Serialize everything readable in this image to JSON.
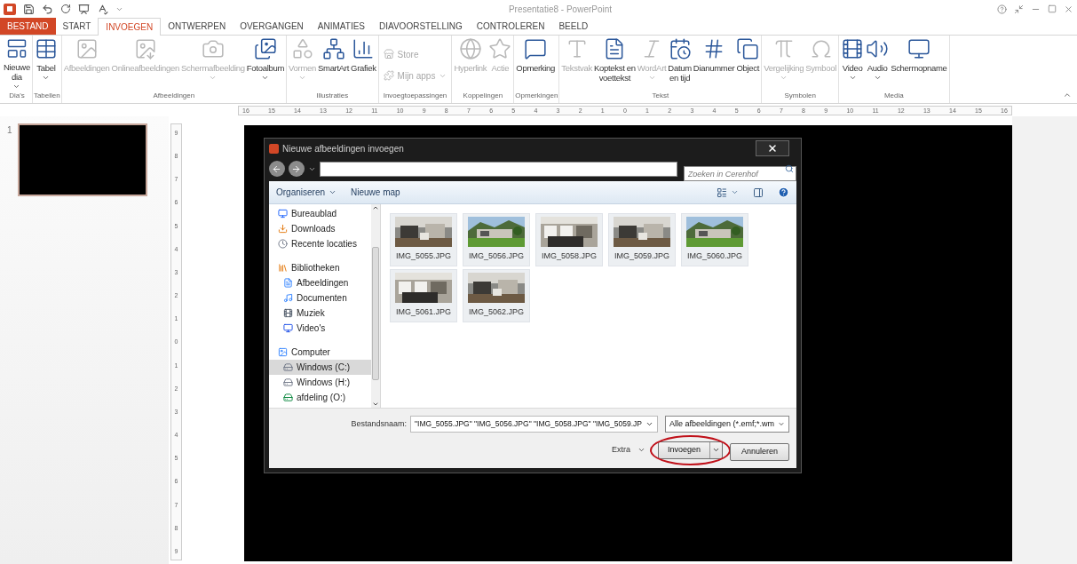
{
  "window": {
    "title": "Presentatie8 - PowerPoint"
  },
  "tabs": [
    {
      "label": "BESTAND",
      "kind": "file",
      "selected": false
    },
    {
      "label": "START",
      "kind": "tab",
      "selected": false
    },
    {
      "label": "INVOEGEN",
      "kind": "tab",
      "selected": true
    },
    {
      "label": "ONTWERPEN",
      "kind": "tab",
      "selected": false
    },
    {
      "label": "OVERGANGEN",
      "kind": "tab",
      "selected": false
    },
    {
      "label": "ANIMATIES",
      "kind": "tab",
      "selected": false
    },
    {
      "label": "DIAVOORSTELLING",
      "kind": "tab",
      "selected": false
    },
    {
      "label": "CONTROLEREN",
      "kind": "tab",
      "selected": false
    },
    {
      "label": "BEELD",
      "kind": "tab",
      "selected": false
    }
  ],
  "ribbon": {
    "groups": [
      {
        "label": "Dia's",
        "buttons": [
          {
            "label": "Nieuwe\ndia",
            "kind": "large",
            "disabled": false,
            "dropdown": true
          }
        ]
      },
      {
        "label": "Tabellen",
        "buttons": [
          {
            "label": "Tabel",
            "kind": "large",
            "disabled": false,
            "dropdown": true
          }
        ]
      },
      {
        "label": "Afbeeldingen",
        "buttons": [
          {
            "label": "Afbeeldingen",
            "kind": "large",
            "disabled": true,
            "dropdown": false
          },
          {
            "label": "Onlineafbeeldingen",
            "kind": "large",
            "disabled": true,
            "dropdown": false
          },
          {
            "label": "Schermafbeelding",
            "kind": "large",
            "disabled": true,
            "dropdown": true
          },
          {
            "label": "Fotoalbum",
            "kind": "large",
            "disabled": false,
            "dropdown": true
          }
        ]
      },
      {
        "label": "Illustraties",
        "buttons": [
          {
            "label": "Vormen",
            "kind": "large",
            "disabled": true,
            "dropdown": true
          },
          {
            "label": "SmartArt",
            "kind": "large",
            "disabled": false,
            "dropdown": false
          },
          {
            "label": "Grafiek",
            "kind": "large",
            "disabled": false,
            "dropdown": false
          }
        ]
      },
      {
        "label": "Invoegtoepassingen",
        "buttons": [
          {
            "label": "Store",
            "kind": "small",
            "disabled": true,
            "dropdown": false
          },
          {
            "label": "Mijn apps",
            "kind": "small",
            "disabled": true,
            "dropdown": true
          }
        ]
      },
      {
        "label": "Koppelingen",
        "buttons": [
          {
            "label": "Hyperlink",
            "kind": "large",
            "disabled": true,
            "dropdown": false
          },
          {
            "label": "Actie",
            "kind": "large",
            "disabled": true,
            "dropdown": false
          }
        ]
      },
      {
        "label": "Opmerkingen",
        "buttons": [
          {
            "label": "Opmerking",
            "kind": "large",
            "disabled": false,
            "dropdown": false
          }
        ]
      },
      {
        "label": "Tekst",
        "buttons": [
          {
            "label": "Tekstvak",
            "kind": "large",
            "disabled": true,
            "dropdown": false
          },
          {
            "label": "Koptekst en\nvoettekst",
            "kind": "large",
            "disabled": false,
            "dropdown": false
          },
          {
            "label": "WordArt",
            "kind": "large",
            "disabled": true,
            "dropdown": true
          },
          {
            "label": "Datum\nen tijd",
            "kind": "large",
            "disabled": false,
            "dropdown": false
          },
          {
            "label": "Dianummer",
            "kind": "large",
            "disabled": false,
            "dropdown": false
          },
          {
            "label": "Object",
            "kind": "large",
            "disabled": false,
            "dropdown": false
          }
        ]
      },
      {
        "label": "Symbolen",
        "buttons": [
          {
            "label": "Vergelijking",
            "kind": "large",
            "disabled": true,
            "dropdown": true
          },
          {
            "label": "Symbool",
            "kind": "large",
            "disabled": true,
            "dropdown": false
          }
        ]
      },
      {
        "label": "Media",
        "buttons": [
          {
            "label": "Video",
            "kind": "large",
            "disabled": false,
            "dropdown": true
          },
          {
            "label": "Audio",
            "kind": "large",
            "disabled": false,
            "dropdown": true
          },
          {
            "label": "Schermopname",
            "kind": "large",
            "disabled": false,
            "dropdown": false
          }
        ]
      }
    ]
  },
  "ruler": {
    "horizontal": [
      "16",
      "15",
      "14",
      "13",
      "12",
      "11",
      "10",
      "9",
      "8",
      "7",
      "6",
      "5",
      "4",
      "3",
      "2",
      "1",
      "0",
      "1",
      "2",
      "3",
      "4",
      "5",
      "6",
      "7",
      "8",
      "9",
      "10",
      "11",
      "12",
      "13",
      "14",
      "15",
      "16"
    ],
    "vertical": [
      "9",
      "8",
      "7",
      "6",
      "5",
      "4",
      "3",
      "2",
      "1",
      "0",
      "1",
      "2",
      "3",
      "4",
      "5",
      "6",
      "7",
      "8",
      "9"
    ]
  },
  "slides": [
    {
      "number": "1",
      "selected": true
    }
  ],
  "dialog": {
    "title": "Nieuwe afbeeldingen invoegen",
    "search": {
      "placeholder": "Zoeken in Cerenhof"
    },
    "toolbar": [
      {
        "label": "Organiseren",
        "dropdown": true
      },
      {
        "label": "Nieuwe map",
        "dropdown": false
      }
    ],
    "nav": [
      {
        "label": "Bureaublad",
        "selected": false
      },
      {
        "label": "Downloads",
        "selected": false
      },
      {
        "label": "Recente locaties",
        "selected": false
      },
      {
        "label": "Bibliotheken",
        "selected": false,
        "children": [
          {
            "label": "Afbeeldingen",
            "selected": false
          },
          {
            "label": "Documenten",
            "selected": false
          },
          {
            "label": "Muziek",
            "selected": false
          },
          {
            "label": "Video's",
            "selected": false
          }
        ]
      },
      {
        "label": "Computer",
        "selected": false,
        "children": [
          {
            "label": "Windows (C:)",
            "selected": true
          },
          {
            "label": "Windows (H:)",
            "selected": false
          },
          {
            "label": "afdeling (O:)",
            "selected": false
          }
        ]
      }
    ],
    "files": [
      {
        "name": "IMG_5055.JPG",
        "kind": "picture"
      },
      {
        "name": "IMG_5056.JPG",
        "kind": "picture"
      },
      {
        "name": "IMG_5058.JPG",
        "kind": "picture"
      },
      {
        "name": "IMG_5059.JPG",
        "kind": "picture"
      },
      {
        "name": "IMG_5060.JPG",
        "kind": "picture"
      },
      {
        "name": "IMG_5061.JPG",
        "kind": "picture"
      },
      {
        "name": "IMG_5062.JPG",
        "kind": "picture"
      }
    ],
    "filename": {
      "label": "Bestandsnaam:",
      "value": "\"IMG_5055.JPG\" \"IMG_5056.JPG\" \"IMG_5058.JPG\" \"IMG_5059.JP"
    },
    "filter": {
      "value": "Alle afbeeldingen (*.emf;*.wm"
    },
    "tools": {
      "label": "Extra"
    },
    "buttons": [
      {
        "label": "Invoegen",
        "kind": "split",
        "highlighted": true
      },
      {
        "label": "Annuleren",
        "kind": "plain",
        "highlighted": false
      }
    ]
  }
}
